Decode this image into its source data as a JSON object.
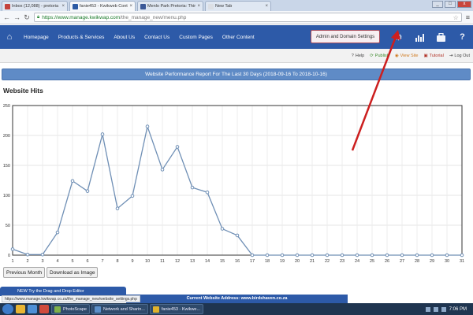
{
  "browser": {
    "tabs": [
      {
        "label": "Inbox (12,088) - pretoria",
        "color": "#c4423c"
      },
      {
        "label": "fanie453 - Kwikweb Cont",
        "color": "#2b5aa4"
      },
      {
        "label": "Menlo Park Pretoria: Thin",
        "color": "#3b5998"
      },
      {
        "label": "New Tab",
        "color": "#dcdfe4"
      }
    ],
    "window_buttons": [
      "_",
      "□",
      "x"
    ],
    "url_host": "https://www.manage.kwikwap.com",
    "url_path": "/the_manage_new/menu.php"
  },
  "navbar": {
    "items": [
      "Homepage",
      "Products & Services",
      "About Us",
      "Contact Us",
      "Custom Pages",
      "Other Content"
    ],
    "admin_button": "Admin and Domain Settings"
  },
  "subbar": {
    "help": "Help",
    "publish": "Publish",
    "view_site": "View Site",
    "tutorial": "Tutorial",
    "log_out": "Log Out"
  },
  "report_title": "Website Performance Report For The Last 30 Days (2018-09-16 To 2018-10-16)",
  "hits_title": "Website Hits",
  "chart_data": {
    "type": "line",
    "x": [
      1,
      2,
      3,
      4,
      5,
      6,
      7,
      8,
      9,
      10,
      11,
      12,
      13,
      14,
      15,
      16,
      17,
      18,
      19,
      20,
      21,
      22,
      23,
      24,
      25,
      26,
      27,
      28,
      29,
      30,
      31
    ],
    "values": [
      10,
      1,
      1,
      38,
      124,
      107,
      202,
      78,
      99,
      215,
      143,
      181,
      113,
      105,
      44,
      33,
      0,
      0,
      0,
      0,
      0,
      0,
      0,
      0,
      0,
      0,
      0,
      0,
      0,
      0,
      0
    ],
    "ylim": [
      0,
      250
    ],
    "yticks": [
      0,
      50,
      100,
      150,
      200,
      250
    ],
    "grid": true,
    "line_color": "#6f8fb5"
  },
  "buttons": {
    "previous_month": "Previous Month",
    "download": "Download as Image"
  },
  "bottom": {
    "blue_label": "NEW Try the Drag and Drop Editor",
    "status_url": "https://www.manage.kwikwap.co.za/the_manage_new/website_settings.php",
    "current_address": "Current Website Address: www.birdshaven.co.za"
  },
  "taskbar": {
    "apps": [
      "PhotoScape",
      "Network and Sharin...",
      "fanie453 - Kwikwe..."
    ],
    "time": "7:06 PM"
  },
  "annotation_color": "#cc1f1f"
}
